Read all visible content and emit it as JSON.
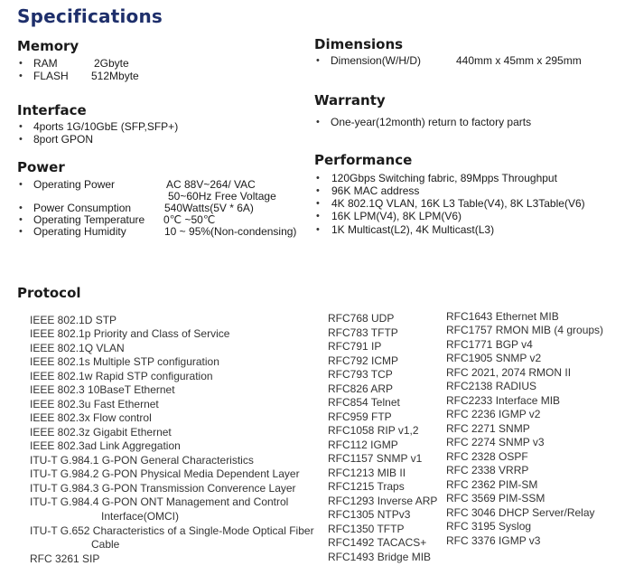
{
  "page": {
    "title": "Specifications"
  },
  "memory": {
    "heading": "Memory",
    "items": [
      {
        "label": "RAM",
        "value": "2Gbyte"
      },
      {
        "label": "FLASH",
        "value": "512Mbyte"
      }
    ]
  },
  "interface": {
    "heading": "Interface",
    "items": [
      "4ports 1G/10GbE (SFP,SFP+)",
      "8port GPON"
    ]
  },
  "power": {
    "heading": "Power",
    "items": [
      {
        "label": "Operating Power",
        "value": "AC 88V~264/ VAC",
        "value2": "50~60Hz  Free Voltage"
      },
      {
        "label": "Power Consumption",
        "value": "540Watts(5V * 6A)"
      },
      {
        "label": "Operating Temperature",
        "value": "0℃ ~50℃"
      },
      {
        "label": "Operating Humidity",
        "value": "10 ~ 95%(Non-condensing)"
      }
    ]
  },
  "dimensions": {
    "heading": "Dimensions",
    "items": [
      {
        "label": "Dimension(W/H/D)",
        "value": "440mm x 45mm x 295mm"
      }
    ]
  },
  "warranty": {
    "heading": "Warranty",
    "items": [
      "One-year(12month) return to factory parts"
    ]
  },
  "performance": {
    "heading": "Performance",
    "items": [
      "120Gbps Switching fabric, 89Mpps Throughput",
      "96K MAC  address",
      "4K 802.1Q VLAN,  16K L3 Table(V4), 8K L3Table(V6)",
      "16K LPM(V4),  8K LPM(V6)",
      "1K Multicast(L2), 4K Multicast(L3)"
    ]
  },
  "protocol": {
    "heading": "Protocol",
    "col1": [
      "IEEE 802.1D STP",
      "IEEE 802.1p Priority and Class of Service",
      "IEEE 802.1Q VLAN",
      "IEEE 802.1s Multiple STP configuration",
      "IEEE 802.1w Rapid STP configuration",
      "IEEE 802.3 10BaseT Ethernet",
      "IEEE 802.3u Fast Ethernet",
      "IEEE 802.3x Flow control",
      "IEEE 802.3z Gigabit Ethernet",
      "IEEE 802.3ad Link Aggregation",
      "ITU-T G.984.1 G-PON General Characteristics",
      "ITU-T G.984.2 G-PON Physical Media Dependent Layer",
      "ITU-T G.984.3 G-PON Transmission Converence Layer",
      "ITU-T G.984.4 G-PON ONT Management and Control",
      "Interface(OMCI)",
      "ITU-T G.652 Characteristics of a Single-Mode Optical Fiber",
      "Cable",
      "RFC 3261 SIP"
    ],
    "col2": [
      "RFC768 UDP",
      "RFC783 TFTP",
      "RFC791 IP",
      "RFC792 ICMP",
      "RFC793 TCP",
      "RFC826 ARP",
      "RFC854 Telnet",
      "RFC959 FTP",
      "RFC1058 RIP v1,2",
      "RFC112 IGMP",
      "RFC1157 SNMP v1",
      "RFC1213 MIB II",
      "RFC1215 Traps",
      "RFC1293 Inverse ARP",
      "RFC1305 NTPv3",
      "RFC1350 TFTP",
      "RFC1492 TACACS+",
      "RFC1493 Bridge MIB"
    ],
    "col3": [
      "RFC1643 Ethernet MIB",
      "RFC1757 RMON MIB (4 groups)",
      "RFC1771 BGP v4",
      "RFC1905 SNMP v2",
      "RFC 2021, 2074 RMON II",
      "RFC2138 RADIUS",
      "RFC2233 Interface MIB",
      "RFC 2236 IGMP v2",
      "RFC 2271 SNMP",
      "RFC 2274 SNMP v3",
      "RFC 2328 OSPF",
      "RFC 2338 VRRP",
      "RFC 2362 PIM-SM",
      "RFC 3569 PIM-SSM",
      "RFC 3046 DHCP Server/Relay",
      "RFC 3195 Syslog",
      "RFC 3376 IGMP v3"
    ]
  }
}
